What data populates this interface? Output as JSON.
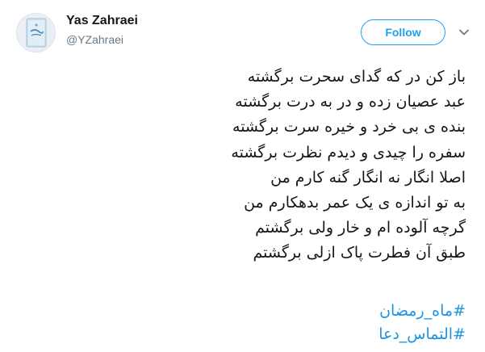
{
  "user": {
    "name": "Yas Zahraei",
    "handle": "@YZahraei"
  },
  "actions": {
    "follow_label": "Follow",
    "menu_icon": "chevron-down-icon"
  },
  "tweet": {
    "lines": [
      "باز کن در که گدای سحرت برگشته",
      "عبد عصیان زده و در به درت برگشته",
      "بنده ی بی خرد و خیره سرت برگشته",
      "سفره را چیدی و دیدم نظرت برگشته",
      "اصلا انگار نه انگار گنه کارم من",
      "به تو اندازه ی یک عمر بدهکارم من",
      "گرچه آلوده ام و خار ولی برگشتم",
      "طبق آن فطرت پاک ازلی برگشتم"
    ],
    "hashtags": [
      "#ماه_رمضان",
      "#التماس_دعا"
    ]
  },
  "colors": {
    "accent": "#1da1f2",
    "link": "#1b95e0",
    "text": "#14171a",
    "muted": "#657786"
  }
}
